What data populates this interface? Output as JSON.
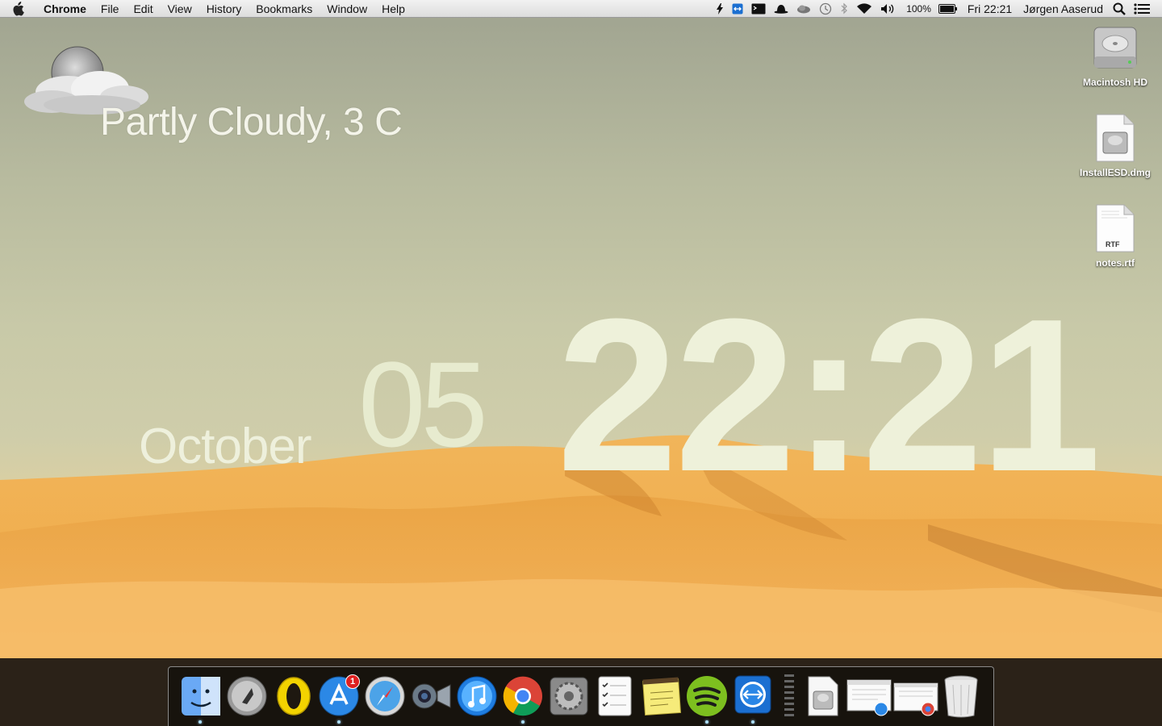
{
  "menubar": {
    "app_name": "Chrome",
    "menus": [
      "File",
      "Edit",
      "View",
      "History",
      "Bookmarks",
      "Window",
      "Help"
    ],
    "battery_percent": "100%",
    "clock": "Fri 22:21",
    "user": "Jørgen Aaserud"
  },
  "widgets": {
    "weather": "Partly Cloudy, 3 C",
    "month": "October",
    "day": "05",
    "time": "22:21"
  },
  "desktop_icons": [
    {
      "label": "Macintosh HD",
      "icon": "hard-drive-icon"
    },
    {
      "label": "InstallESD.dmg",
      "icon": "disk-image-icon"
    },
    {
      "label": "notes.rtf",
      "icon": "rtf-document-icon",
      "badge_text": "RTF"
    }
  ],
  "dock": {
    "items": [
      "finder",
      "launchpad",
      "opera",
      "app-store",
      "safari",
      "facetime",
      "itunes",
      "chrome",
      "system-preferences",
      "reminders",
      "stickies",
      "spotify",
      "teamviewer",
      "downloads-stack",
      "minimized-window-appstore",
      "minimized-window-chrome",
      "trash"
    ],
    "app_store_badge": "1"
  },
  "colors": {
    "sky_top": "#9fa390",
    "sand": "#e6a850",
    "clock_text": "#eef1da"
  }
}
